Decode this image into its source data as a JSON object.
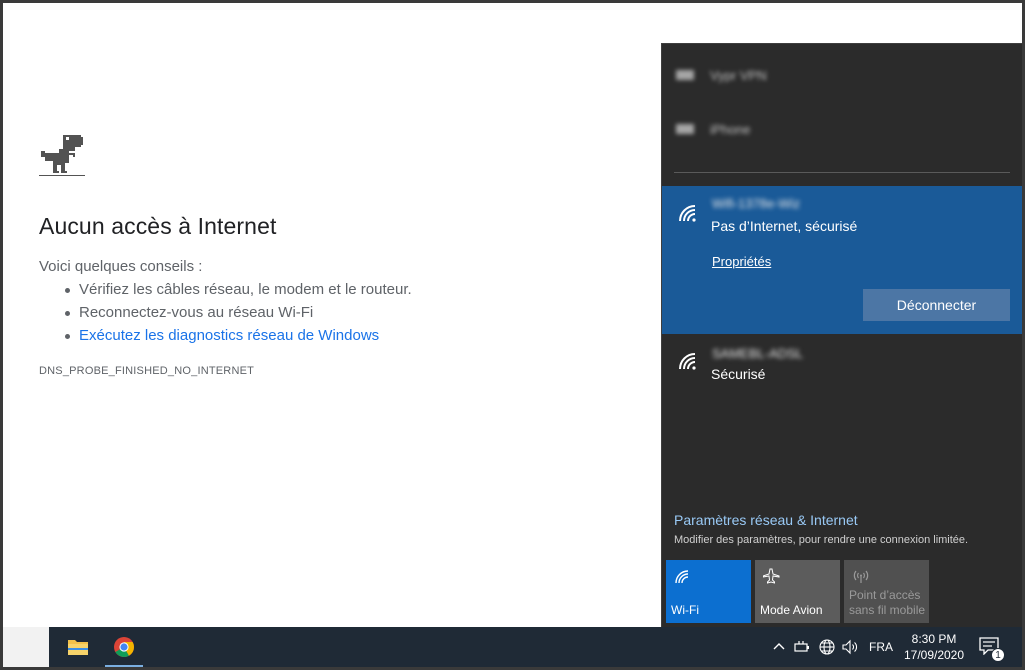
{
  "error_page": {
    "title": "Aucun accès à Internet",
    "intro": "Voici quelques conseils :",
    "tips": [
      "Vérifiez les câbles réseau, le modem et le routeur.",
      "Reconnectez-vous au réseau Wi-Fi",
      "Exécutez les diagnostics réseau de Windows"
    ],
    "error_code": "DNS_PROBE_FINISHED_NO_INTERNET"
  },
  "network_flyout": {
    "blurred_networks": [
      {
        "ssid": "Vypr VPN",
        "icon": "vpn-icon"
      },
      {
        "ssid": "iPhone",
        "icon": "vpn-icon"
      }
    ],
    "connected_network": {
      "ssid": "Wifi-1378e-Wiz",
      "status": "Pas d’Internet, sécurisé",
      "properties_label": "Propriétés",
      "disconnect_label": "Déconnecter",
      "icon": "wifi-icon"
    },
    "other_network": {
      "ssid": "SAMEBL-ADSL",
      "status": "Sécurisé",
      "icon": "wifi-icon"
    },
    "settings_link": "Paramètres réseau & Internet",
    "settings_desc": "Modifier des paramètres, pour rendre une connexion limitée.",
    "tiles": {
      "wifi": "Wi-Fi",
      "airplane": "Mode Avion",
      "hotspot_line1": "Point d’accès",
      "hotspot_line2": "sans fil mobile"
    }
  },
  "taskbar": {
    "language": "FRA",
    "time": "8:30 PM",
    "date": "17/09/2020",
    "notification_count": "1"
  },
  "colors": {
    "accent_blue": "#1a5a98",
    "wifi_tile": "#0c6fd0",
    "link_blue": "#1a73e8",
    "settings_link": "#99c9f5"
  }
}
